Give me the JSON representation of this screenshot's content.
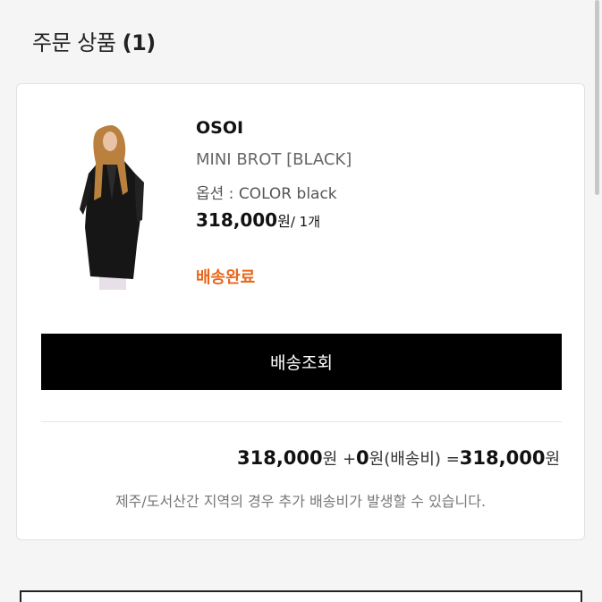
{
  "section": {
    "title": "주문 상품",
    "count": "(1)"
  },
  "order_item": {
    "brand": "OSOI",
    "product_name": "MINI BROT [BLACK]",
    "option": "옵션 : COLOR black",
    "price": "318,000",
    "price_unit": "원",
    "quantity": "/ 1개",
    "status": "배송완료",
    "track_button": "배송조회"
  },
  "summary": {
    "product_total": "318,000",
    "product_total_unit": "원",
    "plus": "+",
    "shipping": "0",
    "shipping_unit": "원(배송비)",
    "equals": "=",
    "grand_total": "318,000",
    "grand_total_unit": "원",
    "notice": "제주/도서산간 지역의 경우 추가 배송비가 발생할 수 있습니다."
  },
  "colors": {
    "status": "#e8661b",
    "button_bg": "#000000"
  }
}
